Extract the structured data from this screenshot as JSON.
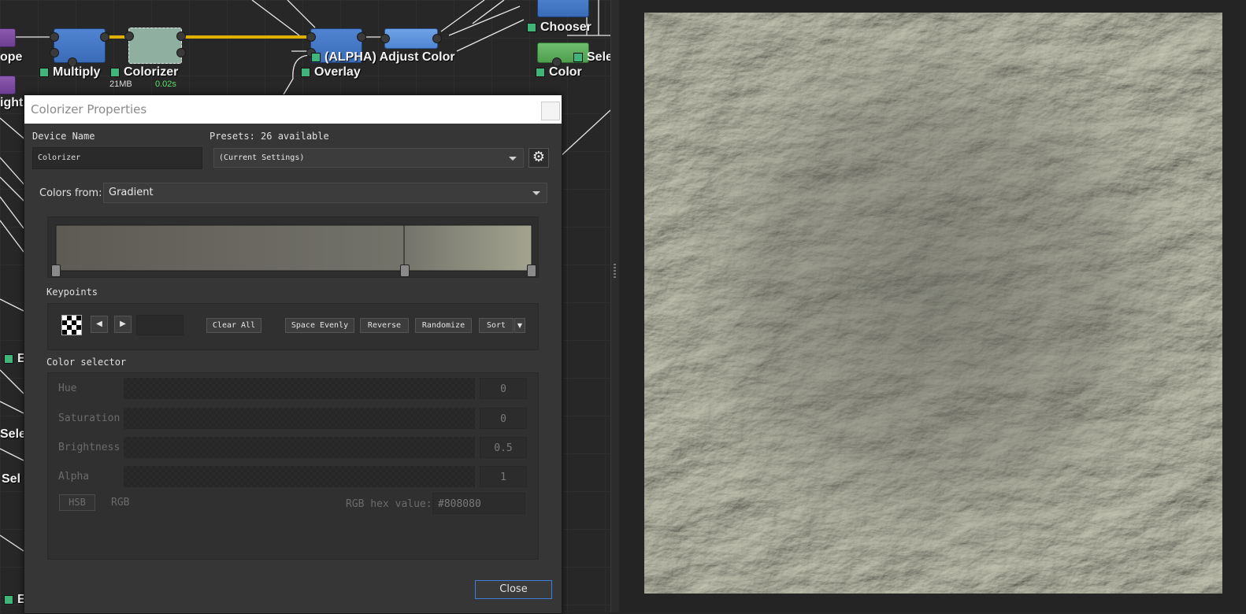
{
  "graph": {
    "nodes": {
      "ope": "ope",
      "ight": "ight",
      "multiply": "Multiply",
      "colorizer": "Colorizer",
      "colorizer_mem": "21MB",
      "colorizer_time": "0.02s",
      "adjust_color": "(ALPHA) Adjust Color",
      "overlay": "Overlay",
      "chooser": "Chooser",
      "sele_top": "Sele",
      "color": "Color",
      "e1": "E",
      "sele_left": "Sele",
      "sel_left2": "Sel",
      "e2": "E"
    }
  },
  "dialog": {
    "title": "Colorizer Properties",
    "device_name_label": "Device Name",
    "device_name_value": "Colorizer",
    "presets_label": "Presets: 26 available",
    "presets_value": "(Current Settings)",
    "colors_from_label": "Colors from:",
    "colors_from_value": "Gradient",
    "gradient": {
      "stops": [
        {
          "position": 0.0,
          "color": "#5e5a54"
        },
        {
          "position": 0.73,
          "color": "#73736a"
        },
        {
          "position": 1.0,
          "color": "#a3a390"
        }
      ]
    },
    "keypoints_label": "Keypoints",
    "keypoint_buttons": {
      "clear_all": "Clear All",
      "space_evenly": "Space Evenly",
      "reverse": "Reverse",
      "randomize": "Randomize",
      "sort": "Sort"
    },
    "color_selector_label": "Color selector",
    "sliders": [
      {
        "label": "Hue",
        "value": "0"
      },
      {
        "label": "Saturation",
        "value": "0"
      },
      {
        "label": "Brightness",
        "value": "0.5"
      },
      {
        "label": "Alpha",
        "value": "1"
      }
    ],
    "mode_hsb": "HSB",
    "mode_rgb": "RGB",
    "hex_label": "RGB hex value:",
    "hex_value": "#808080",
    "close_label": "Close"
  },
  "colors": {
    "accent_blue": "#3a6cb8",
    "node_green": "#3fb57a",
    "terrain_base": "#a8a898",
    "close_border": "#3b7fd8"
  }
}
